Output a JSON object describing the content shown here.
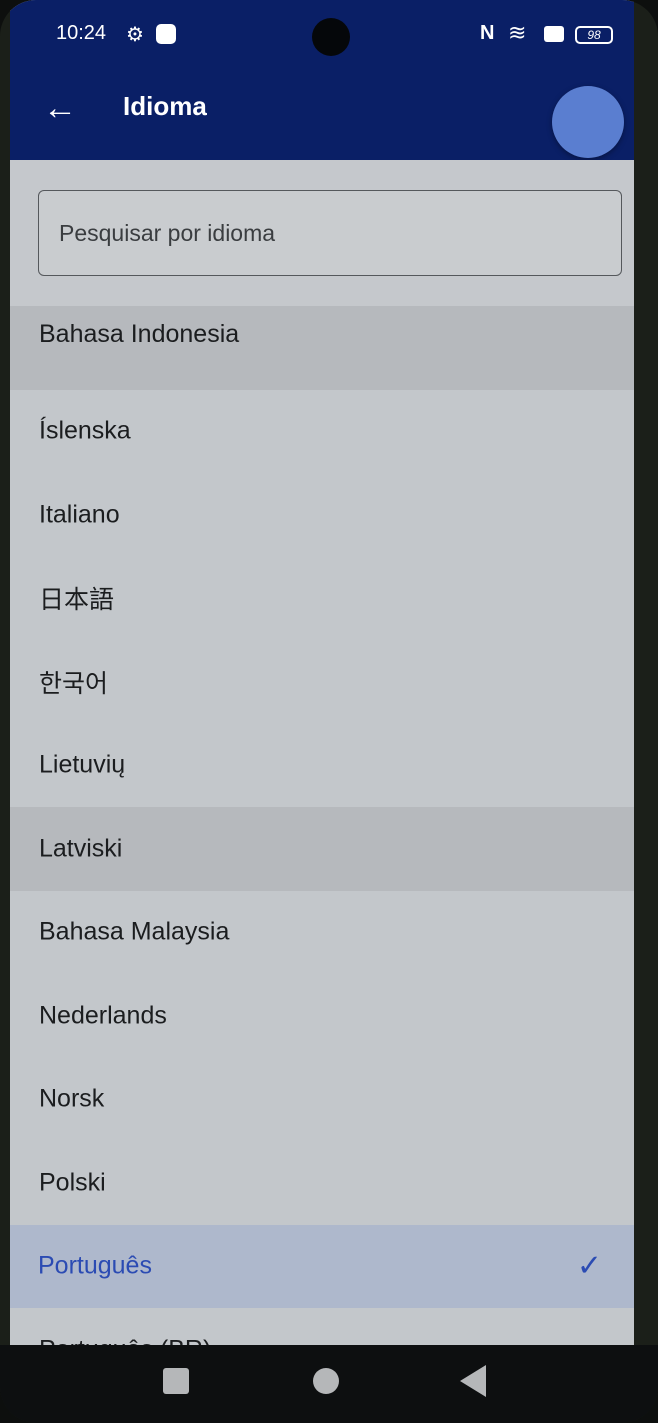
{
  "status_bar": {
    "time": "10:24",
    "battery": "98",
    "icons": [
      "gear-icon",
      "message-icon",
      "nfc-icon",
      "wifi-icon",
      "notification-icon",
      "battery-icon"
    ]
  },
  "appbar": {
    "title": "Idioma",
    "back_icon": "arrow-left-icon",
    "color": "#0a1f66"
  },
  "search": {
    "placeholder": "Pesquisar por idioma",
    "value": ""
  },
  "languages": [
    {
      "label": "Bahasa Indonesia"
    },
    {
      "label": "Íslenska"
    },
    {
      "label": "Italiano"
    },
    {
      "label": "日本語"
    },
    {
      "label": "한국어"
    },
    {
      "label": "Lietuvių"
    },
    {
      "label": "Latviski"
    },
    {
      "label": "Bahasa Malaysia"
    },
    {
      "label": "Nederlands"
    },
    {
      "label": "Norsk"
    },
    {
      "label": "Polski"
    },
    {
      "label": "Português",
      "selected": true
    },
    {
      "label": "Português (BR)"
    }
  ],
  "selected_language": "Português",
  "accent_color": "#2b4bb3",
  "check_icon": "✓",
  "back_glyph": "←",
  "nav": [
    "recent-apps-icon",
    "home-icon",
    "back-icon"
  ]
}
